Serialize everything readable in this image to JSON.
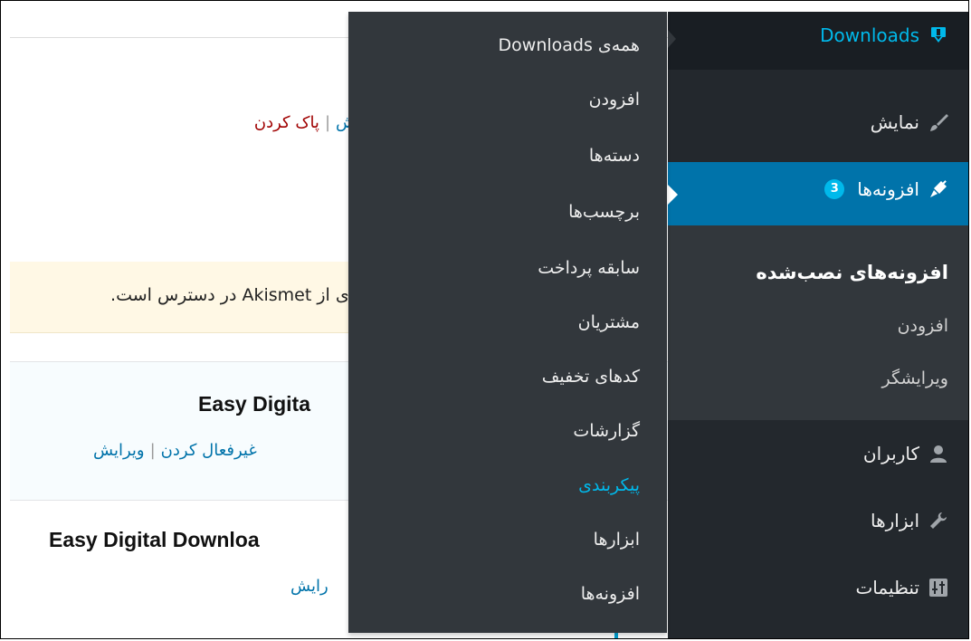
{
  "content": {
    "top_actions": {
      "trailing_fragment": "ش",
      "clear_label": "پاک کردن"
    },
    "notice_text": "ای از Akismet در دسترس است.",
    "plugins": [
      {
        "title": "Easy Digita",
        "actions": {
          "deactivate": "غیرفعال کردن",
          "edit": "ویرایش"
        }
      },
      {
        "title": "Easy Digital Downloa",
        "actions": {
          "edit_fragment": "رایش"
        }
      }
    ]
  },
  "flyout": {
    "items": [
      {
        "label": "همه‌ی Downloads",
        "active": false
      },
      {
        "label": "افزودن",
        "active": false
      },
      {
        "label": "دسته‌ها",
        "active": false
      },
      {
        "label": "برچسب‌ها",
        "active": false
      },
      {
        "label": "سابقه پرداخت",
        "active": false
      },
      {
        "label": "مشتریان",
        "active": false
      },
      {
        "label": "کدهای تخفیف",
        "active": false
      },
      {
        "label": "گزارشات",
        "active": false
      },
      {
        "label": "پیکربندی",
        "active": true
      },
      {
        "label": "ابزارها",
        "active": false
      },
      {
        "label": "افزونه‌ها",
        "active": false
      }
    ]
  },
  "sidebar": {
    "downloads": {
      "label": "Downloads",
      "icon": "download-icon"
    },
    "appearance": {
      "label": "نمایش",
      "icon": "paintbrush-icon"
    },
    "plugins": {
      "label": "افزونه‌ها",
      "badge": "3",
      "icon": "plugin-icon"
    },
    "plugins_submenu": {
      "installed": "افزونه‌های نصب‌شده",
      "add_new": "افزودن",
      "editor": "ویرایشگر"
    },
    "users": {
      "label": "کاربران",
      "icon": "users-icon"
    },
    "tools": {
      "label": "ابزارها",
      "icon": "wrench-icon"
    },
    "settings": {
      "label": "تنظیمات",
      "icon": "settings-icon"
    }
  },
  "colors": {
    "sidebar_bg": "#23282d",
    "flyout_bg": "#32373c",
    "active_bg": "#0073aa",
    "accent": "#00b9eb",
    "link": "#0073aa",
    "danger_link": "#a00000"
  }
}
